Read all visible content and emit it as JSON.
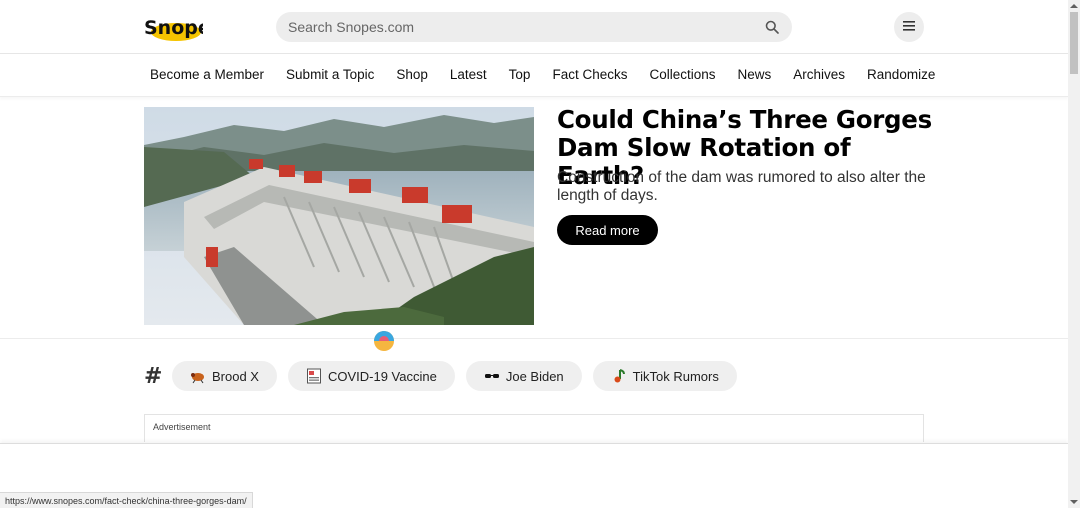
{
  "header": {
    "logo_text": "Snopes",
    "search_placeholder": "Search Snopes.com",
    "search_icon": "search-icon",
    "menu_icon": "hamburger-menu-icon"
  },
  "nav": {
    "items": [
      {
        "label": "Become a Member"
      },
      {
        "label": "Submit a Topic"
      },
      {
        "label": "Shop"
      },
      {
        "label": "Latest"
      },
      {
        "label": "Top"
      },
      {
        "label": "Fact Checks"
      },
      {
        "label": "Collections"
      },
      {
        "label": "News"
      },
      {
        "label": "Archives"
      },
      {
        "label": "Randomize"
      }
    ]
  },
  "feature": {
    "title": "Could China’s Three Gorges Dam Slow Rotation of Earth?",
    "subtitle": "Construction of the dam was rumored to also alter the length of days.",
    "read_more": "Read more"
  },
  "tags": {
    "hash": "#",
    "items": [
      {
        "label": "Brood X",
        "icon": "cicada-icon"
      },
      {
        "label": "COVID-19 Vaccine",
        "icon": "vaccine-card-icon"
      },
      {
        "label": "Joe Biden",
        "icon": "sunglasses-icon"
      },
      {
        "label": "TikTok Rumors",
        "icon": "music-note-icon"
      }
    ]
  },
  "ad": {
    "label": "Advertisement"
  },
  "status_bar": {
    "url": "https://www.snopes.com/fact-check/china-three-gorges-dam/"
  },
  "colors": {
    "logo_yellow": "#f5c400",
    "button_black": "#000000",
    "pill_gray": "#efefef"
  }
}
